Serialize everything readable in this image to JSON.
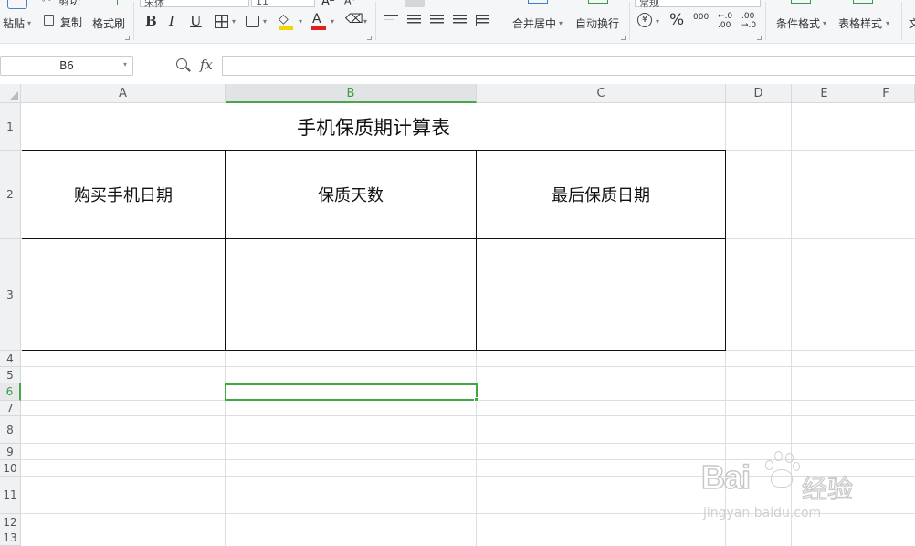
{
  "ribbon": {
    "cut_label": "剪切",
    "paste_label": "粘贴",
    "copy_label": "复制",
    "format_painter_label": "格式刷",
    "font_name": "宋体",
    "font_size": "11",
    "bold": "B",
    "italic": "I",
    "underline": "U",
    "merge_center_label": "合并居中",
    "wrap_text_label": "自动换行",
    "number_format": "常规",
    "percent": "%",
    "thousands": "000",
    "conditional_format_label": "条件格式",
    "table_style_label": "表格样式",
    "overflow_char": "文"
  },
  "formula_bar": {
    "name_box": "B6",
    "fx_label": "fx",
    "formula": ""
  },
  "columns": [
    "A",
    "B",
    "C",
    "D",
    "E",
    "F"
  ],
  "rows": [
    "1",
    "2",
    "3",
    "4",
    "5",
    "6",
    "7",
    "8",
    "9",
    "10",
    "11",
    "12",
    "13"
  ],
  "selected_cell": "B6",
  "sheet": {
    "title": "手机保质期计算表",
    "headers": [
      "购买手机日期",
      "保质天数",
      "最后保质日期"
    ]
  },
  "watermark": {
    "brand": "Bai",
    "brand_suffix": "经验",
    "url": "jingyan.baidu.com"
  },
  "colors": {
    "selection": "#3fa83f",
    "grid": "#dcdee1",
    "header_bg": "#f0f1f3"
  }
}
